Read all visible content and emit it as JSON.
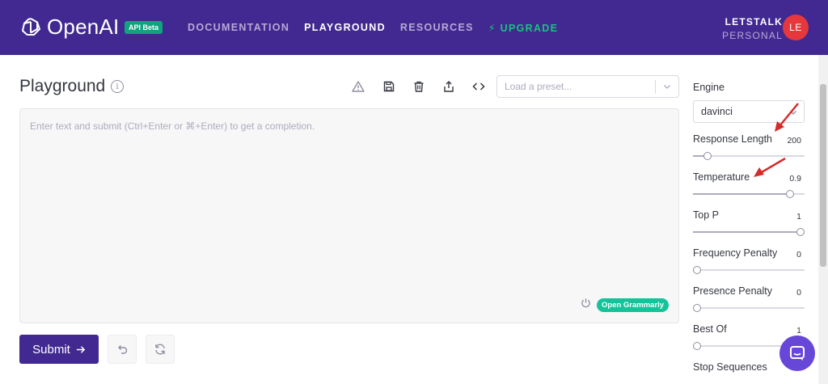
{
  "header": {
    "brand": "OpenAI",
    "badge": "API Beta",
    "nav": [
      {
        "label": "DOCUMENTATION",
        "state": "normal"
      },
      {
        "label": "PLAYGROUND",
        "state": "active"
      },
      {
        "label": "RESOURCES",
        "state": "normal"
      },
      {
        "label": "⚡ UPGRADE",
        "state": "upgrade"
      }
    ],
    "account": {
      "org": "LETSTALK",
      "plan": "PERSONAL",
      "initials": "LE"
    }
  },
  "main": {
    "title": "Playground",
    "toolbar_icons": [
      "warning-icon",
      "save-icon",
      "trash-icon",
      "share-icon",
      "code-icon"
    ],
    "preset": {
      "placeholder": "Load a preset..."
    },
    "editor": {
      "placeholder": "Enter text and submit (Ctrl+Enter or ⌘+Enter) to get a completion."
    },
    "grammarly": {
      "label": "Open Grammarly"
    },
    "submit": {
      "label": "Submit"
    }
  },
  "sidebar": {
    "engine": {
      "label": "Engine",
      "value": "davinci"
    },
    "settings": [
      {
        "label": "Response Length",
        "value": "200",
        "level": 0.1
      },
      {
        "label": "Temperature",
        "value": "0.9",
        "level": 0.9
      },
      {
        "label": "Top P",
        "value": "1",
        "level": 1.0
      },
      {
        "label": "Frequency Penalty",
        "value": "0",
        "level": 0.0
      },
      {
        "label": "Presence Penalty",
        "value": "0",
        "level": 0.0
      },
      {
        "label": "Best Of",
        "value": "1",
        "level": 0.0
      }
    ],
    "stop_sequences": {
      "label": "Stop Sequences"
    }
  },
  "colors": {
    "header_bg": "#412991",
    "accent": "#10a37f",
    "annotation_arrow": "#d62b2b",
    "chat": "#6747d7"
  }
}
